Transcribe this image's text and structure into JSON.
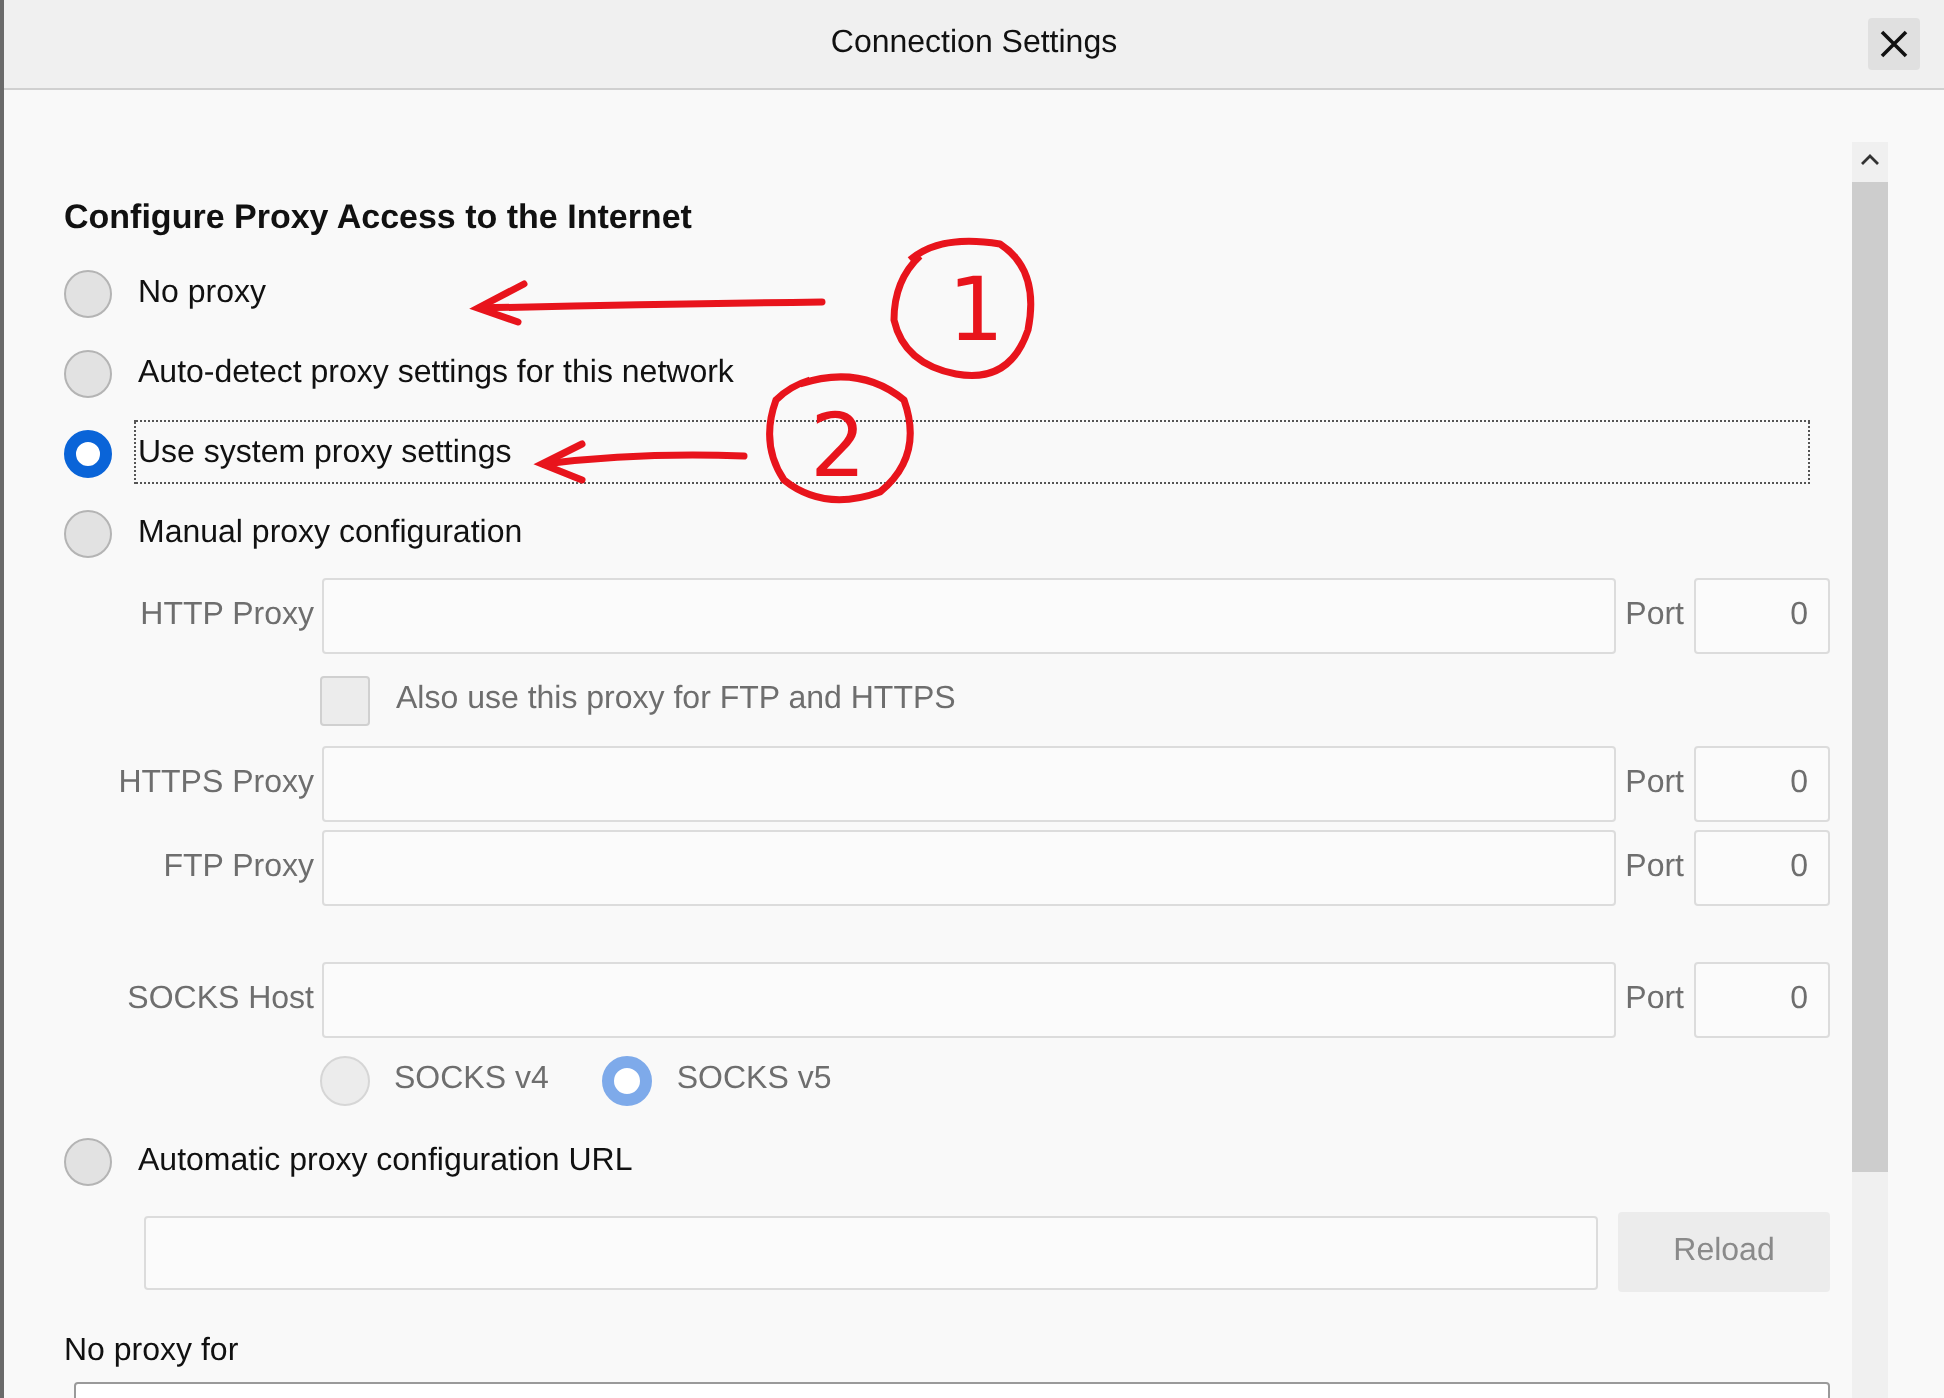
{
  "window": {
    "title": "Connection Settings"
  },
  "section_title": "Configure Proxy Access to the Internet",
  "proxy_modes": [
    {
      "label": "No proxy",
      "selected": false
    },
    {
      "label": "Auto-detect proxy settings for this network",
      "selected": false
    },
    {
      "label": "Use system proxy settings",
      "selected": true
    },
    {
      "label": "Manual proxy configuration",
      "selected": false
    },
    {
      "label": "Automatic proxy configuration URL",
      "selected": false
    }
  ],
  "manual": {
    "disabled": true,
    "fields": [
      {
        "label": "HTTP Proxy",
        "port_label": "Port",
        "port": "0"
      },
      {
        "label": "HTTPS Proxy",
        "port_label": "Port",
        "port": "0"
      },
      {
        "label": "FTP Proxy",
        "port_label": "Port",
        "port": "0"
      },
      {
        "label": "SOCKS Host",
        "port_label": "Port",
        "port": "0"
      }
    ],
    "share_checkbox": {
      "label": "Also use this proxy for FTP and HTTPS",
      "checked": false
    },
    "socks_versions": [
      {
        "label": "SOCKS v4",
        "selected": false
      },
      {
        "label": "SOCKS v5",
        "selected": true
      }
    ]
  },
  "auto_config": {
    "disabled": true,
    "reload_button": "Reload"
  },
  "no_proxy_for": {
    "label": "No proxy for"
  },
  "annotations": [
    {
      "number": "1"
    },
    {
      "number": "2"
    }
  ]
}
